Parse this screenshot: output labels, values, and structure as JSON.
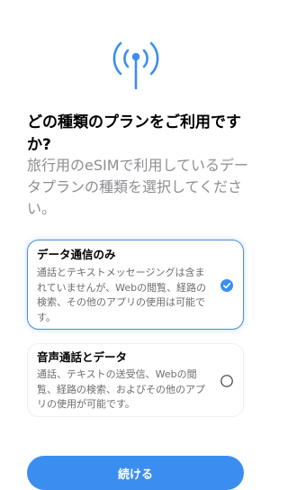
{
  "header": {
    "icon": "antenna-signal-icon",
    "title": "どの種類のプランをご利用ですか?",
    "subtitle": "旅行用のeSIMで利用しているデータプランの種類を選択してください。"
  },
  "options": [
    {
      "title": "データ通信のみ",
      "description": "通話とテキストメッセージングは含まれていませんが、Webの閲覧、経路の検索、その他のアプリの使用は可能です。",
      "selected": true
    },
    {
      "title": "音声通話とデータ",
      "description": "通話、テキストの送受信、Webの閲覧、経路の検索、およびその他のアプリの使用が可能です。",
      "selected": false
    }
  ],
  "footer": {
    "continue_label": "続ける"
  },
  "colors": {
    "accent": "#3a8ef0",
    "secondary_text": "#8e8e93"
  }
}
